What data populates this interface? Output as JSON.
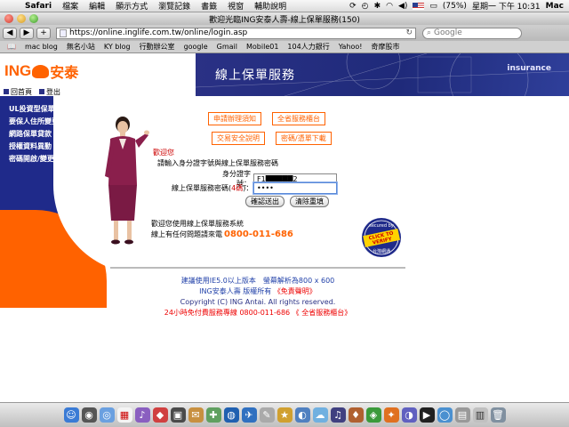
{
  "menubar": {
    "app": "Safari",
    "items": [
      "檔案",
      "編輯",
      "顯示方式",
      "瀏覽記錄",
      "書籤",
      "視窗",
      "輔助說明"
    ],
    "battery": "(75%)",
    "clock": "星期一 下午 10:31",
    "user": "Mac"
  },
  "window": {
    "title": "歡迎光臨ING安泰人壽-線上保單服務(150)",
    "url": "https://online.inglife.com.tw/online/login.asp",
    "search_placeholder": "Google"
  },
  "bookmarks": [
    "mac blog",
    "無名小站",
    "KY blog",
    "行動辦公室",
    "google",
    "Gmail",
    "Mobile01",
    "104人力銀行",
    "Yahoo!",
    "奇摩股市"
  ],
  "header": {
    "logo_latin": "ING",
    "logo_chinese": "安泰",
    "banner_title": "線上保單服務",
    "banner_word": "insurance",
    "nav_home": "回首頁",
    "nav_logout": "登出"
  },
  "sidebar": {
    "items": [
      "UL投資型保單內容變更",
      "要保人住所變更",
      "網路保單貸款",
      "授權資料異動",
      "密碼開啟/變更"
    ]
  },
  "buttons": {
    "apply_notice": "申請辦理須知",
    "branch": "全省服務櫃台",
    "security": "交易安全說明",
    "password_forgot": "密碼/憑單下載"
  },
  "login": {
    "welcome": "歡迎您",
    "instruction": "請輸入身分證字號與線上保單服務密碼",
    "id_label": "身分證字號：",
    "id_value": "F1█████2",
    "pw_label_pre": "線上保單服務密碼(",
    "pw_label_red": "4碼",
    "pw_label_post": ")：",
    "pw_value": "••••",
    "submit": "確認送出",
    "clear": "清除重填"
  },
  "hotline": {
    "line1": "歡迎您使用線上保單服務系統",
    "line2_prefix": "線上有任何問題請來電",
    "number": "0800-011-686"
  },
  "seal": {
    "top": "secured by",
    "main1": "CLICK TO",
    "main2": "VERIFY",
    "bottom": "台灣網通"
  },
  "footer": {
    "line1": "建議使用IE5.0以上版本　螢幕解析為800 x 600",
    "line2_pre": "ING安泰人壽 版權所有",
    "line2_link": "《免責聲明》",
    "line3": "Copyright (C) ING Antai. All rights reserved.",
    "line4": "24小時免付費服務專線 0800-011-686 《 全省服務櫃台》"
  },
  "colors": {
    "ing_orange": "#ff6200",
    "ing_blue": "#2a3185"
  }
}
